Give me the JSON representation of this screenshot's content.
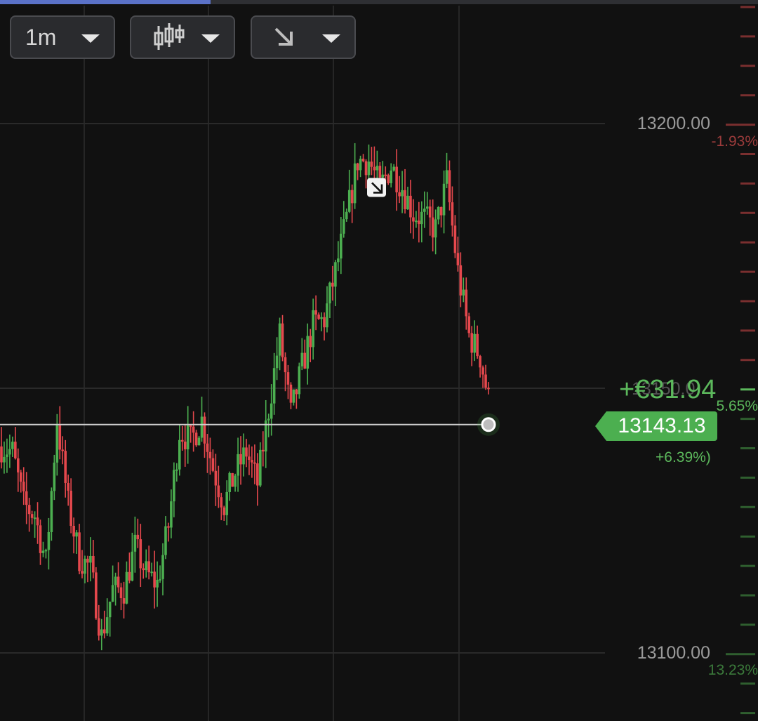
{
  "progress": 0.278,
  "toolbar": {
    "interval_label": "1m",
    "chart_type_icon": "candlestick-icon",
    "trend_icon": "arrow-down-right-icon"
  },
  "price_levels": {
    "upper": "13200.00",
    "lower": "13100.00",
    "mid_overlapped": "13150.0"
  },
  "percent_labels": {
    "top": "-1.93%",
    "middle": "5.65%",
    "bottom": "13.23%"
  },
  "position": {
    "profit": "+€31.94",
    "current_price": "13143.13",
    "change_pct": "+6.39%)"
  },
  "colors": {
    "bull": "#4caf50",
    "bear": "#e5484d",
    "background": "#111111"
  },
  "chart_data": {
    "type": "candlestick",
    "ylim": [
      13087,
      13223
    ],
    "y_ticks": [
      13100,
      13150,
      13200
    ],
    "current_price": 13143.13,
    "trend_marker_price": 13188,
    "anchors": [
      {
        "i": 0,
        "p": 13139
      },
      {
        "i": 4,
        "p": 13138
      },
      {
        "i": 8,
        "p": 13128
      },
      {
        "i": 12,
        "p": 13126
      },
      {
        "i": 16,
        "p": 13117
      },
      {
        "i": 20,
        "p": 13144
      },
      {
        "i": 24,
        "p": 13128
      },
      {
        "i": 28,
        "p": 13118
      },
      {
        "i": 32,
        "p": 13116
      },
      {
        "i": 36,
        "p": 13103
      },
      {
        "i": 40,
        "p": 13112
      },
      {
        "i": 44,
        "p": 13112
      },
      {
        "i": 48,
        "p": 13120
      },
      {
        "i": 52,
        "p": 13115
      },
      {
        "i": 56,
        "p": 13113
      },
      {
        "i": 60,
        "p": 13124
      },
      {
        "i": 64,
        "p": 13142
      },
      {
        "i": 68,
        "p": 13140
      },
      {
        "i": 72,
        "p": 13144
      },
      {
        "i": 76,
        "p": 13135
      },
      {
        "i": 80,
        "p": 13128
      },
      {
        "i": 84,
        "p": 13134
      },
      {
        "i": 88,
        "p": 13138
      },
      {
        "i": 92,
        "p": 13132
      },
      {
        "i": 96,
        "p": 13146
      },
      {
        "i": 100,
        "p": 13160
      },
      {
        "i": 104,
        "p": 13145
      },
      {
        "i": 108,
        "p": 13154
      },
      {
        "i": 112,
        "p": 13162
      },
      {
        "i": 116,
        "p": 13163
      },
      {
        "i": 120,
        "p": 13172
      },
      {
        "i": 124,
        "p": 13182
      },
      {
        "i": 128,
        "p": 13193
      },
      {
        "i": 132,
        "p": 13193
      },
      {
        "i": 136,
        "p": 13188
      },
      {
        "i": 140,
        "p": 13192
      },
      {
        "i": 144,
        "p": 13188
      },
      {
        "i": 148,
        "p": 13183
      },
      {
        "i": 152,
        "p": 13182
      },
      {
        "i": 156,
        "p": 13180
      },
      {
        "i": 160,
        "p": 13189
      },
      {
        "i": 164,
        "p": 13172
      },
      {
        "i": 168,
        "p": 13160
      },
      {
        "i": 172,
        "p": 13156
      },
      {
        "i": 175,
        "p": 13148
      }
    ],
    "count": 176
  }
}
